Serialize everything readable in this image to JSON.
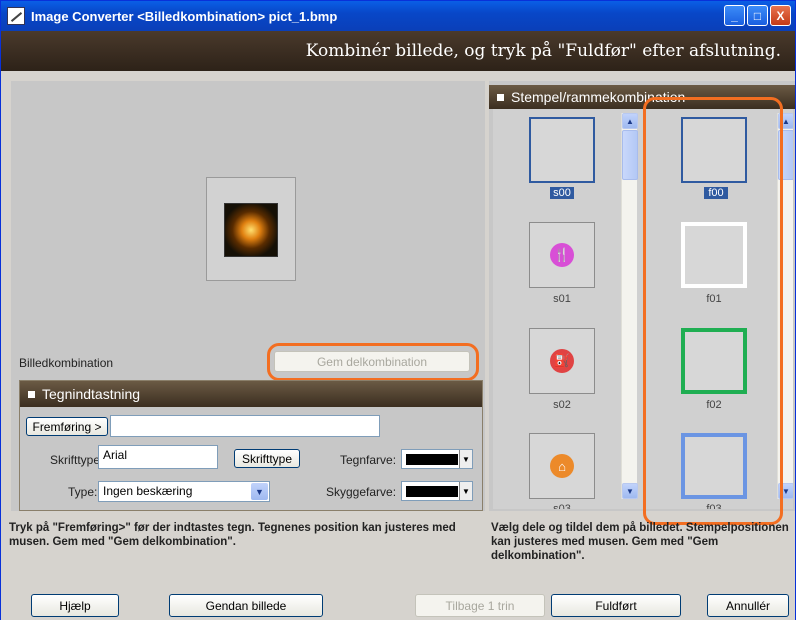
{
  "window": {
    "title": "Image Converter <Billedkombination> pict_1.bmp",
    "controls": [
      "_",
      "□",
      "X"
    ]
  },
  "header": {
    "instruction": "Kombinér billede, og tryk på \"Fuldfør\" efter afslutning."
  },
  "left": {
    "combo_label": "Billedkombination",
    "save_partial_label": "Gem delkombination",
    "section_title": "Tegnindtastning",
    "forward_button": "Fremføring >",
    "text_input_value": "",
    "font_label": "Skrifttype:",
    "font_value": "Arial",
    "font_button": "Skrifttype",
    "text_color_label": "Tegnfarve:",
    "type_label": "Type:",
    "type_value": "Ingen beskæring",
    "shadow_color_label": "Skyggefarve:",
    "help_text": "Tryk på \"Fremføring>\" før der indtastes tegn. Tegnenes position kan justeres med musen. Gem med \"Gem delkombination\"."
  },
  "right": {
    "section_title": "Stempel/rammekombination",
    "stamps": [
      {
        "label": "s00",
        "icon": "empty"
      },
      {
        "label": "s01",
        "icon": "fork-knife-icon",
        "glyph": "🍴",
        "color": "#d84fd6"
      },
      {
        "label": "s02",
        "icon": "fuel-pump-icon",
        "glyph": "⛽",
        "color": "#e04343"
      },
      {
        "label": "s03",
        "icon": "home-icon",
        "glyph": "⌂",
        "color": "#ec8a2a"
      }
    ],
    "frames": [
      {
        "label": "f00"
      },
      {
        "label": "f01"
      },
      {
        "label": "f02"
      },
      {
        "label": "f03"
      }
    ],
    "help_text": "Vælg dele og tildel dem på billedet. Stempelpositionen kan justeres med musen. Gem med \"Gem delkombination\"."
  },
  "footer": {
    "help": "Hjælp",
    "restore": "Gendan billede",
    "undo": "Tilbage 1 trin",
    "done": "Fuldført",
    "cancel": "Annullér"
  },
  "colors": {
    "highlight": "#f36e21",
    "selected": "#2f5aa0",
    "frame_green": "#1fae52",
    "frame_blue": "#6b95e3"
  }
}
